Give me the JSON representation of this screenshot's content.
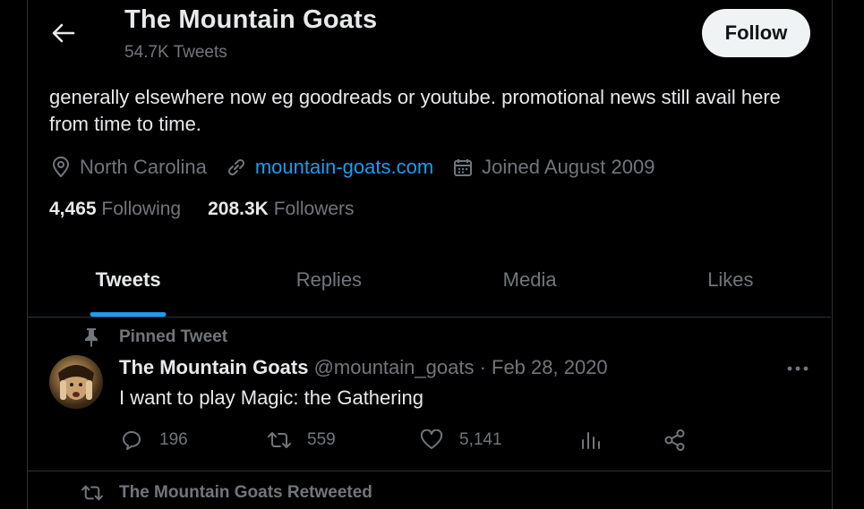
{
  "header": {
    "title": "The Mountain Goats",
    "tweet_count": "54.7K Tweets",
    "follow_label": "Follow"
  },
  "profile": {
    "bio": "generally elsewhere now eg goodreads or youtube. promotional news still avail here from time to time.",
    "location": "North Carolina",
    "website": "mountain-goats.com",
    "joined": "Joined August 2009",
    "following_count": "4,465",
    "following_label": "Following",
    "followers_count": "208.3K",
    "followers_label": "Followers"
  },
  "tabs": [
    {
      "label": "Tweets",
      "active": true
    },
    {
      "label": "Replies",
      "active": false
    },
    {
      "label": "Media",
      "active": false
    },
    {
      "label": "Likes",
      "active": false
    }
  ],
  "pinned_tweet": {
    "context": "Pinned Tweet",
    "author_name": "The Mountain Goats",
    "handle_date": " @mountain_goats · Feb 28, 2020",
    "text": "I want to play Magic: the Gathering",
    "replies": "196",
    "retweets": "559",
    "likes": "5,141"
  },
  "next_tweet": {
    "context": "The Mountain Goats Retweeted"
  },
  "colors": {
    "background": "#000000",
    "accent": "#1d9bf0",
    "muted": "#71767b",
    "text": "#e7e9ea",
    "follow_bg": "#eff3f4"
  },
  "icons": [
    "back-arrow-icon",
    "location-pin-icon",
    "link-icon",
    "calendar-icon",
    "pin-icon",
    "more-icon",
    "reply-icon",
    "retweet-icon",
    "like-icon",
    "views-icon",
    "share-icon"
  ]
}
